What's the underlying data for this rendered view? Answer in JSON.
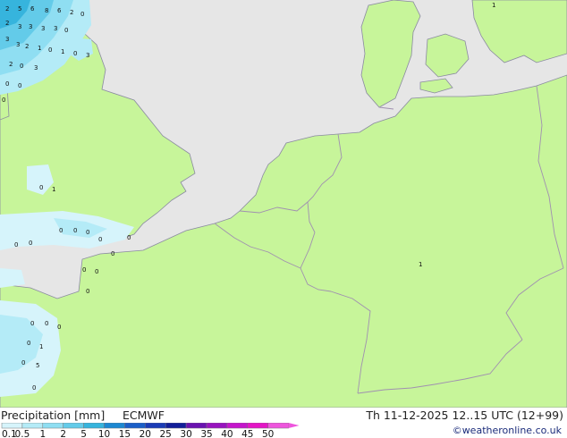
{
  "header": {
    "title": "Precipitation [mm]",
    "model": "ECMWF",
    "valid_time": "Th 11-12-2025 12..15 UTC (12+99)",
    "credit": "©weatheronline.co.uk"
  },
  "legend": {
    "ticks": [
      "0.1",
      "0.5",
      "1",
      "2",
      "5",
      "10",
      "15",
      "20",
      "25",
      "30",
      "35",
      "40",
      "45",
      "50"
    ],
    "colors": [
      "#d6f4fb",
      "#b4ebf7",
      "#8fdef2",
      "#63cbe9",
      "#36b4dd",
      "#1c88d2",
      "#1a5ec8",
      "#1a3bb6",
      "#121e99",
      "#6a12b0",
      "#9813bf",
      "#c515cc",
      "#e415c6",
      "#ee55dd"
    ]
  },
  "map": {
    "colors": {
      "sea": "#e6e6e6",
      "land_rain_free": "#c7f59a",
      "border": "#a090b0",
      "coast": "#8a8aa0"
    },
    "labels": [
      {
        "text": "2"
      },
      {
        "text": "5"
      },
      {
        "text": "6"
      },
      {
        "text": "8"
      },
      {
        "text": "6"
      },
      {
        "text": "2"
      },
      {
        "text": "0"
      },
      {
        "text": "2"
      },
      {
        "text": "3"
      },
      {
        "text": "3"
      },
      {
        "text": "3"
      },
      {
        "text": "3"
      },
      {
        "text": "0"
      },
      {
        "text": "3"
      },
      {
        "text": "3"
      },
      {
        "text": "2"
      },
      {
        "text": "1"
      },
      {
        "text": "0"
      },
      {
        "text": "1"
      },
      {
        "text": "0"
      },
      {
        "text": "3"
      },
      {
        "text": "2"
      },
      {
        "text": "0"
      },
      {
        "text": "3"
      },
      {
        "text": "0"
      },
      {
        "text": "0"
      },
      {
        "text": "0"
      },
      {
        "text": "0"
      },
      {
        "text": "1"
      },
      {
        "text": "0"
      },
      {
        "text": "0"
      },
      {
        "text": "0"
      },
      {
        "text": "0"
      },
      {
        "text": "0"
      },
      {
        "text": "0"
      },
      {
        "text": "0"
      },
      {
        "text": "0"
      },
      {
        "text": "0"
      },
      {
        "text": "0"
      },
      {
        "text": "0"
      },
      {
        "text": "0"
      },
      {
        "text": "0"
      },
      {
        "text": "0"
      },
      {
        "text": "1"
      },
      {
        "text": "0"
      },
      {
        "text": "5"
      },
      {
        "text": "0"
      },
      {
        "text": "0"
      },
      {
        "text": "1"
      },
      {
        "text": "1"
      }
    ]
  }
}
